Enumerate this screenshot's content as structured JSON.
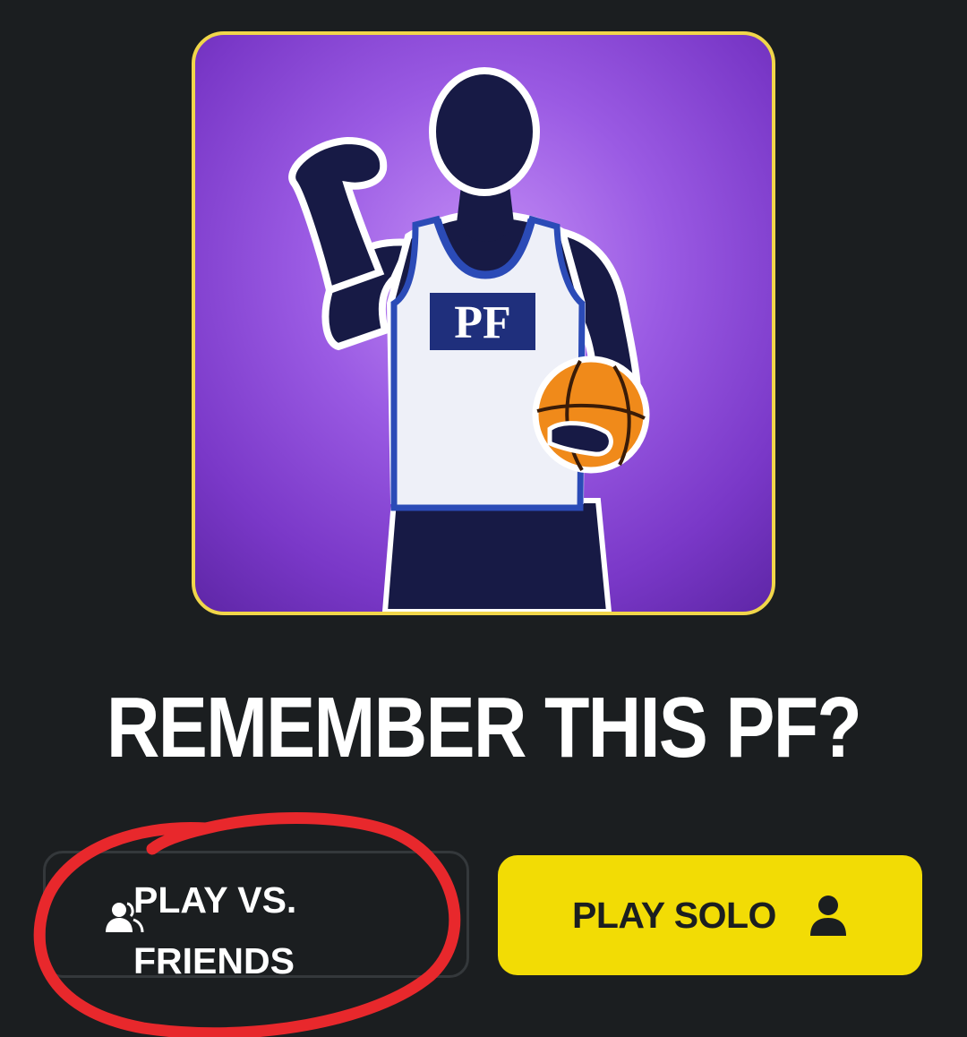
{
  "artwork": {
    "jersey_text": "PF",
    "icon": "basketball-player-silhouette",
    "border_color": "#f1d64a",
    "background_color": "#9a5ae3"
  },
  "heading": {
    "title": "REMEMBER THIS PF?"
  },
  "buttons": {
    "friends": {
      "line1": "PLAY VS.",
      "line2": "FRIENDS",
      "icon": "users-icon"
    },
    "solo": {
      "label": "PLAY SOLO",
      "icon": "user-icon",
      "background": "#f2dc05"
    }
  },
  "annotation": {
    "color": "#e8282c",
    "type": "hand-drawn-circle"
  }
}
